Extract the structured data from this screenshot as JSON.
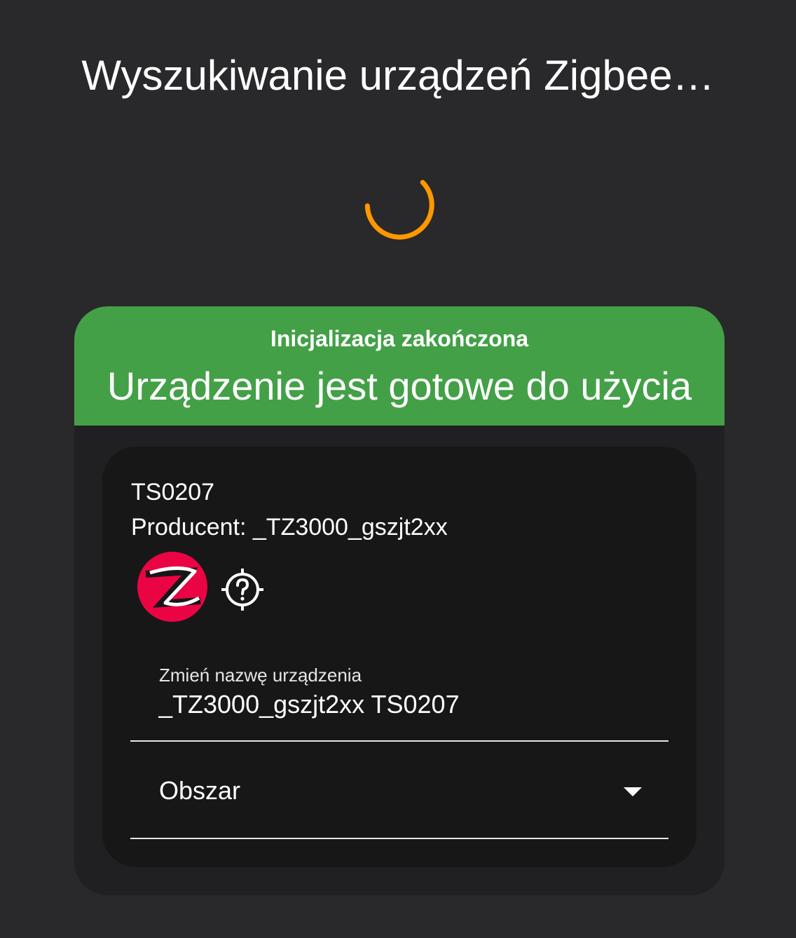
{
  "header": {
    "title": "Wyszukiwanie urządzeń Zigbee…"
  },
  "spinner": {
    "icon": "loading-spinner-icon",
    "color": "#ff9800"
  },
  "status": {
    "subtitle": "Inicjalizacja zakończona",
    "title": "Urządzenie jest gotowe do użycia",
    "color": "#43a047"
  },
  "device": {
    "model": "TS0207",
    "manufacturer_line": "Producent: _TZ3000_gszjt2xx",
    "logo_icon": "zigbee-logo-icon",
    "logo_color": "#eb0443",
    "identify_icon": "identify-target-icon"
  },
  "form": {
    "rename_label": "Zmień nazwę urządzenia",
    "rename_value": "_TZ3000_gszjt2xx TS0207",
    "area_label": "Obszar",
    "area_icon": "chevron-down-icon"
  }
}
